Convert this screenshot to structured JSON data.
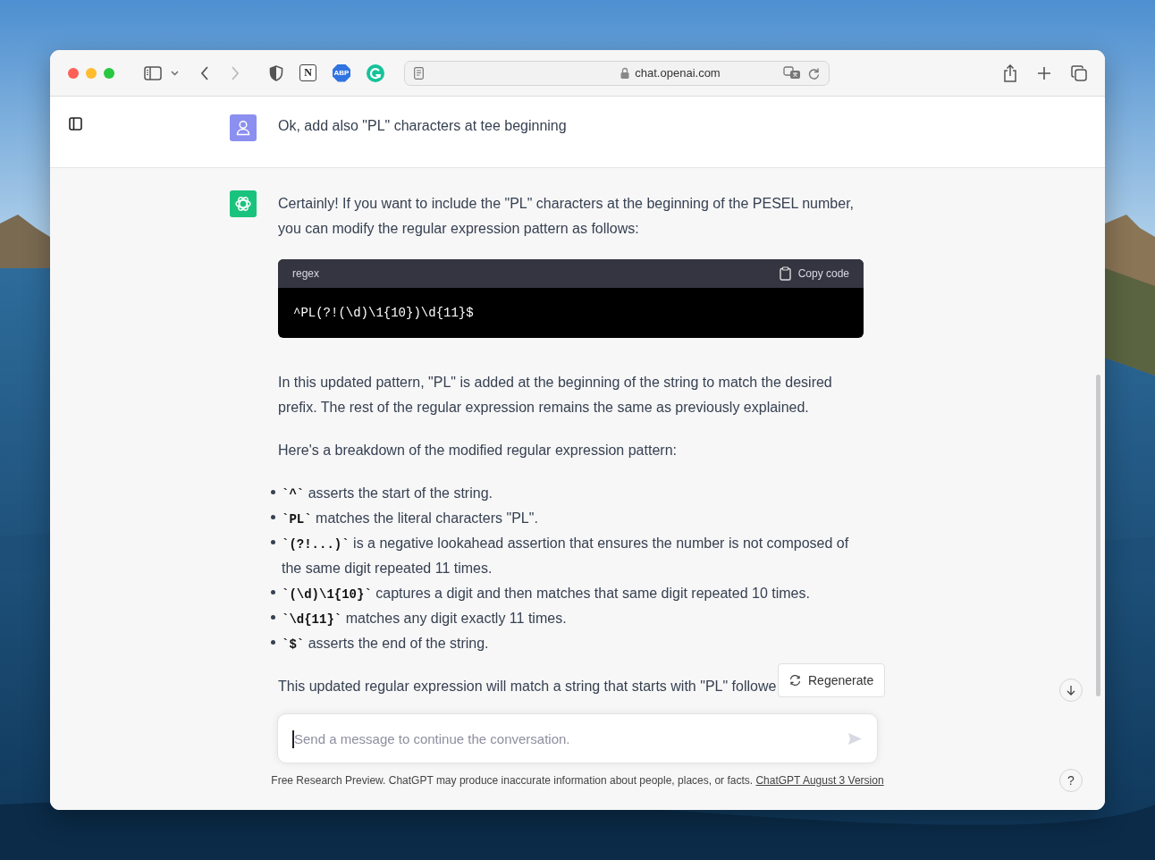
{
  "browser": {
    "url": "chat.openai.com",
    "back_disabled": false,
    "forward_disabled": true,
    "extensions": [
      {
        "kind": "shield"
      },
      {
        "kind": "notion",
        "label": "N"
      },
      {
        "kind": "abp",
        "label": "ABP"
      },
      {
        "kind": "grammarly"
      }
    ]
  },
  "messages": [
    {
      "kind": "user",
      "text": "Ok, add also \"PL\" characters at tee beginning"
    },
    {
      "kind": "assistant",
      "blocks": [
        {
          "kind": "paragraph",
          "text": "Certainly! If you want to include the \"PL\" characters at the beginning of the PESEL number, you can modify the regular expression pattern as follows:"
        },
        {
          "kind": "code",
          "language": "regex",
          "copy_label": "Copy code",
          "code": "^PL(?!(\\d)\\1{10})\\d{11}$"
        },
        {
          "kind": "paragraph",
          "text": "In this updated pattern, \"PL\" is added at the beginning of the string to match the desired prefix. The rest of the regular expression remains the same as previously explained."
        },
        {
          "kind": "paragraph",
          "text": "Here's a breakdown of the modified regular expression pattern:"
        },
        {
          "kind": "bullets",
          "items": [
            {
              "code": "`^`",
              "text": "asserts the start of the string."
            },
            {
              "code": "`PL`",
              "text": "matches the literal characters \"PL\"."
            },
            {
              "code": "`(?!...)`",
              "text": "is a negative lookahead assertion that ensures the number is not composed of the same digit repeated 11 times."
            },
            {
              "code": "`(\\d)\\1{10}`",
              "text": "captures a digit and then matches that same digit repeated 10 times."
            },
            {
              "code": "`\\d{11}`",
              "text": "matches any digit exactly 11 times."
            },
            {
              "code": "`$`",
              "text": "asserts the end of the string."
            }
          ]
        },
        {
          "kind": "paragraph",
          "text": "This updated regular expression will match a string that starts with \"PL\" followe"
        }
      ]
    }
  ],
  "regenerate": "Regenerate",
  "composer": {
    "placeholder": "Send a message to continue the conversation."
  },
  "footer": {
    "text": "Free Research Preview. ChatGPT may produce inaccurate information about people, places, or facts.",
    "link": "ChatGPT August 3 Version"
  },
  "help": "?"
}
